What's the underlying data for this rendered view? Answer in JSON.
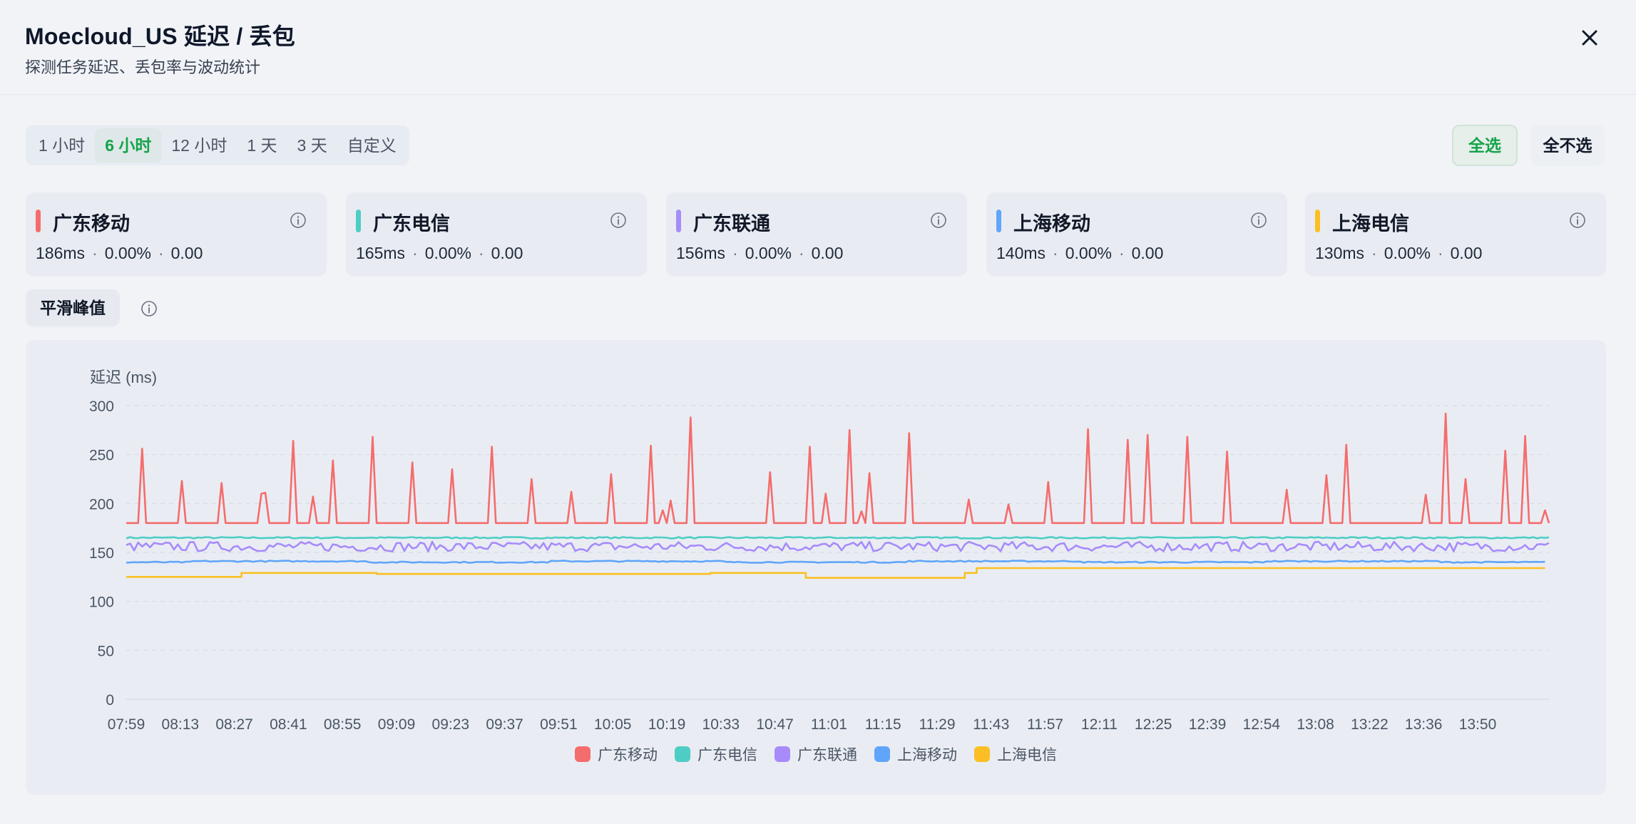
{
  "header": {
    "title": "Moecloud_US 延迟 / 丢包",
    "subtitle": "探测任务延迟、丢包率与波动统计"
  },
  "ranges": [
    {
      "label": "1 小时",
      "active": false
    },
    {
      "label": "6 小时",
      "active": true
    },
    {
      "label": "12 小时",
      "active": false
    },
    {
      "label": "1 天",
      "active": false
    },
    {
      "label": "3 天",
      "active": false
    },
    {
      "label": "自定义",
      "active": false
    }
  ],
  "actions": {
    "select_all": "全选",
    "select_none": "全不选"
  },
  "cards": [
    {
      "name": "广东移动",
      "latency": "186ms",
      "loss": "0.00%",
      "jitter": "0.00",
      "color": "#f56c6c"
    },
    {
      "name": "广东电信",
      "latency": "165ms",
      "loss": "0.00%",
      "jitter": "0.00",
      "color": "#4ecdc4"
    },
    {
      "name": "广东联通",
      "latency": "156ms",
      "loss": "0.00%",
      "jitter": "0.00",
      "color": "#a78bfa"
    },
    {
      "name": "上海移动",
      "latency": "140ms",
      "loss": "0.00%",
      "jitter": "0.00",
      "color": "#60a5fa"
    },
    {
      "name": "上海电信",
      "latency": "130ms",
      "loss": "0.00%",
      "jitter": "0.00",
      "color": "#fbbf24"
    }
  ],
  "controls": {
    "smooth_peak": "平滑峰值"
  },
  "chart_data": {
    "type": "line",
    "ylabel": "延迟 (ms)",
    "ylim": [
      0,
      300
    ],
    "yticks": [
      0,
      50,
      100,
      150,
      200,
      250,
      300
    ],
    "x": [
      "07:59",
      "08:13",
      "08:27",
      "08:41",
      "08:55",
      "09:09",
      "09:23",
      "09:37",
      "09:51",
      "10:05",
      "10:19",
      "10:33",
      "10:47",
      "11:01",
      "11:15",
      "11:29",
      "11:43",
      "11:57",
      "12:11",
      "12:25",
      "12:39",
      "12:54",
      "13:08",
      "13:22",
      "13:36",
      "13:50"
    ],
    "grid": true,
    "legend": "bottom",
    "series": [
      {
        "name": "广东移动",
        "color": "#f56c6c",
        "base": 180,
        "spikes": [
          [
            "08:03",
            256
          ],
          [
            "08:13",
            223
          ],
          [
            "08:23",
            221
          ],
          [
            "08:33",
            210
          ],
          [
            "08:34",
            211
          ],
          [
            "08:41",
            264
          ],
          [
            "08:46",
            207
          ],
          [
            "08:51",
            244
          ],
          [
            "09:01",
            268
          ],
          [
            "09:11",
            242
          ],
          [
            "09:21",
            235
          ],
          [
            "09:31",
            258
          ],
          [
            "09:41",
            225
          ],
          [
            "09:51",
            212
          ],
          [
            "10:01",
            230
          ],
          [
            "10:11",
            259
          ],
          [
            "10:14",
            193
          ],
          [
            "10:16",
            203
          ],
          [
            "10:21",
            288
          ],
          [
            "10:41",
            232
          ],
          [
            "10:51",
            258
          ],
          [
            "10:55",
            210
          ],
          [
            "11:01",
            275
          ],
          [
            "11:04",
            192
          ],
          [
            "11:06",
            231
          ],
          [
            "11:16",
            272
          ],
          [
            "11:31",
            204
          ],
          [
            "11:41",
            199
          ],
          [
            "11:51",
            222
          ],
          [
            "12:01",
            276
          ],
          [
            "12:11",
            265
          ],
          [
            "12:16",
            270
          ],
          [
            "12:26",
            268
          ],
          [
            "12:36",
            253
          ],
          [
            "12:51",
            214
          ],
          [
            "13:01",
            229
          ],
          [
            "13:06",
            260
          ],
          [
            "13:26",
            209
          ],
          [
            "13:31",
            292
          ],
          [
            "13:36",
            225
          ],
          [
            "13:46",
            254
          ],
          [
            "13:51",
            269
          ],
          [
            "13:56",
            193
          ]
        ],
        "end": "13:57"
      },
      {
        "name": "广东电信",
        "color": "#4ecdc4",
        "base": 165,
        "end": "13:57"
      },
      {
        "name": "广东联通",
        "color": "#a78bfa",
        "base": 156,
        "end": "13:57"
      },
      {
        "name": "上海移动",
        "color": "#60a5fa",
        "base": 140,
        "end": "13:56"
      },
      {
        "name": "上海电信",
        "color": "#fbbf24",
        "steps": [
          [
            "07:59",
            125
          ],
          [
            "08:28",
            129
          ],
          [
            "09:02",
            128
          ],
          [
            "10:26",
            129
          ],
          [
            "10:50",
            124
          ],
          [
            "11:30",
            129
          ],
          [
            "11:33",
            134
          ],
          [
            "13:56",
            134
          ]
        ],
        "end": "13:56"
      }
    ]
  }
}
